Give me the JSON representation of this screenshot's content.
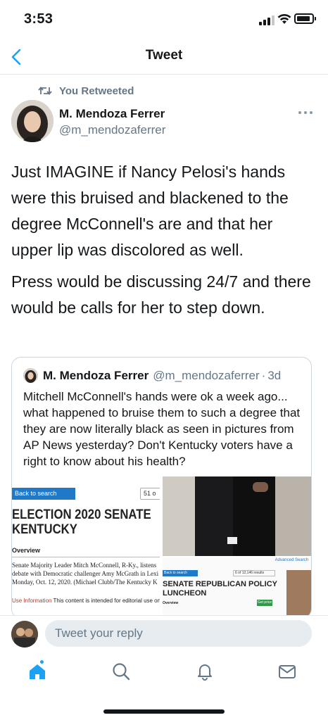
{
  "status_bar": {
    "time": "3:53"
  },
  "header": {
    "title": "Tweet"
  },
  "retweet": {
    "label": "You Retweeted"
  },
  "tweet": {
    "author_name": "M. Mendoza Ferrer",
    "author_handle": "@m_mendozaferrer",
    "paragraphs": [
      "Just IMAGINE if Nancy Pelosi's hands were this bruised and blackened to the degree McConnell's are and that her upper lip was discolored as well.",
      "Press would be discussing 24/7 and there would be calls for her to step down."
    ]
  },
  "quoted_tweet": {
    "author_name": "M. Mendoza Ferrer",
    "author_handle": "@m_mendozaferrer",
    "separator": "·",
    "time": "3d",
    "text": "Mitchell McConnell's hands were ok a week ago... what happened to bruise them to such a degree that they are now literally black as seen in pictures from AP News yesterday?  Don't Kentucky voters have a right to know about his health?",
    "media": {
      "left": {
        "back_label": "Back to search results",
        "pager": "51 o",
        "title_line1": "ELECTION 2020 SENATE",
        "title_line2": "KENTUCKY",
        "overview": "Overview",
        "caption_line1": "Senate Majority Leader Mitch McConnell, R-Ky., listens",
        "caption_line2": "debate with Democratic challenger Amy McGrath in Lexi",
        "caption_line3": "Monday, Oct. 12, 2020. (Michael Clubb/The Kentucky K",
        "use_label": "Use Information",
        "use_text": "This content is intended for editorial use only"
      },
      "bottom_right": {
        "advanced_search": "Advanced Search",
        "back_label": "Back to search results",
        "pager": "6 of 12,146 results",
        "title_line1": "SENATE REPUBLICAN POLICY",
        "title_line2": "LUNCHEON",
        "overview": "Overview",
        "price_button": "Get price"
      }
    }
  },
  "reply": {
    "placeholder": "Tweet your reply"
  },
  "tab_bar": {
    "icons": [
      "home-icon",
      "search-icon",
      "notifications-icon",
      "messages-icon"
    ],
    "accent": "#1da1f2"
  }
}
